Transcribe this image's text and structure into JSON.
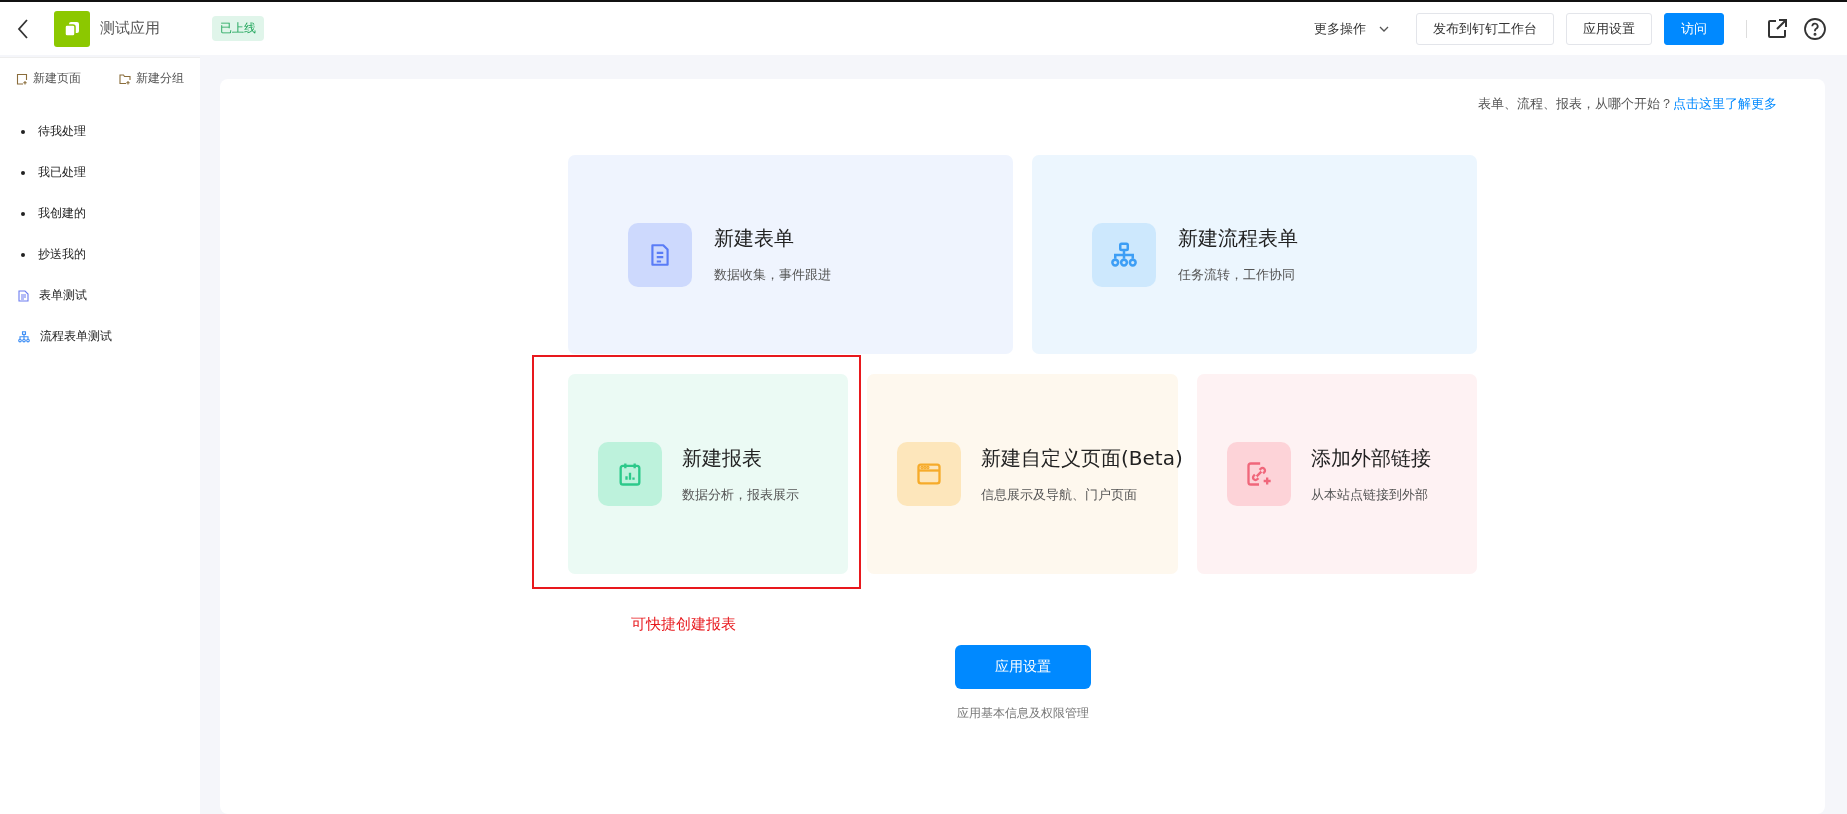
{
  "header": {
    "app_name": "测试应用",
    "status_badge": "已上线",
    "more_menu": "更多操作",
    "buttons": [
      {
        "label": "发布到钉钉工作台",
        "kind": "default"
      },
      {
        "label": "应用设置",
        "kind": "default"
      },
      {
        "label": "访问",
        "kind": "primary"
      }
    ]
  },
  "sidebar": {
    "actions": [
      {
        "label": "新建页面",
        "kind": "page"
      },
      {
        "label": "新建分组",
        "kind": "group"
      }
    ],
    "items": [
      {
        "label": "待我处理",
        "kind": "bullet"
      },
      {
        "label": "我已处理",
        "kind": "bullet"
      },
      {
        "label": "我创建的",
        "kind": "bullet"
      },
      {
        "label": "抄送我的",
        "kind": "bullet"
      },
      {
        "label": "表单测试",
        "kind": "form"
      },
      {
        "label": "流程表单测试",
        "kind": "flow"
      }
    ]
  },
  "hint": {
    "text": "表单、流程、报表，从哪个开始？",
    "link": "点击这里了解更多"
  },
  "cards": [
    {
      "title": "新建表单",
      "subtitle": "数据收集，事件跟进",
      "kind": "form"
    },
    {
      "title": "新建流程表单",
      "subtitle": "任务流转，工作协同",
      "kind": "flow"
    },
    {
      "title": "新建报表",
      "subtitle": "数据分析，报表展示",
      "kind": "report"
    },
    {
      "title": "新建自定义页面(Beta)",
      "subtitle": "信息展示及导航、门户页面",
      "kind": "page"
    },
    {
      "title": "添加外部链接",
      "subtitle": "从本站点链接到外部",
      "kind": "link"
    }
  ],
  "annotation": {
    "text": "可快捷创建报表"
  },
  "settings": {
    "button": "应用设置",
    "caption": "应用基本信息及权限管理"
  }
}
